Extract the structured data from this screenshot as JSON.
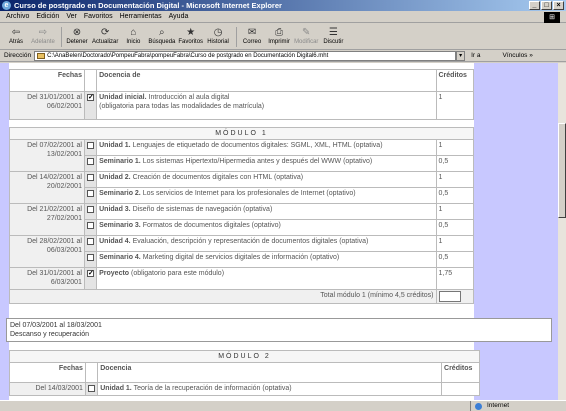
{
  "window": {
    "title": "Curso de postgrado en Documentación Digital - Microsoft Internet Explorer",
    "controls": [
      "_",
      "□",
      "×"
    ]
  },
  "menu": [
    "Archivo",
    "Edición",
    "Ver",
    "Favoritos",
    "Herramientas",
    "Ayuda"
  ],
  "toolbar": [
    {
      "label": "Atrás",
      "icon": "back-arrow",
      "glyph": "⇦",
      "enabled": true
    },
    {
      "label": "Adelante",
      "icon": "forward-arrow",
      "glyph": "⇨",
      "enabled": false
    },
    {
      "label": "Detener",
      "icon": "stop",
      "glyph": "⊗",
      "enabled": true
    },
    {
      "label": "Actualizar",
      "icon": "refresh",
      "glyph": "⟳",
      "enabled": true
    },
    {
      "label": "Inicio",
      "icon": "home",
      "glyph": "⌂",
      "enabled": true
    },
    {
      "label": "Búsqueda",
      "icon": "search",
      "glyph": "⌕",
      "enabled": true
    },
    {
      "label": "Favoritos",
      "icon": "favorites",
      "glyph": "★",
      "enabled": true
    },
    {
      "label": "Historial",
      "icon": "history",
      "glyph": "◷",
      "enabled": true
    },
    {
      "label": "Correo",
      "icon": "mail",
      "glyph": "✉",
      "enabled": true
    },
    {
      "label": "Imprimir",
      "icon": "print",
      "glyph": "⎙",
      "enabled": true
    },
    {
      "label": "Modificar",
      "icon": "edit",
      "glyph": "✎",
      "enabled": false
    },
    {
      "label": "Discutir",
      "icon": "discuss",
      "glyph": "☰",
      "enabled": true
    }
  ],
  "address": {
    "label": "Dirección",
    "value": "C:\\AnaBelen\\Doctorado\\PompeuFabra\\pompeuFabra\\Curso de postgrado en Documentación Digital6.mht",
    "go": "Ir a",
    "links": "Vínculos »"
  },
  "table1": {
    "headers": {
      "fechas": "Fechas",
      "docencia": "Docencia de",
      "creditos": "Créditos"
    },
    "row": {
      "date": "Del 31/01/2001 al 06/02/2001",
      "checked": true,
      "title": "Unidad inicial.",
      "text": " Introducción al aula digital",
      "note": "(obligatoria para todas las modalidades de matrícula)",
      "credit": "1"
    }
  },
  "modulo1": {
    "title": "MÓDULO 1",
    "groups": [
      {
        "date": "Del 07/02/2001 al 13/02/2001",
        "items": [
          {
            "title": "Unidad 1.",
            "text": " Lenguajes de etiquetado de documentos digitales: SGML, XML, HTML (optativa)",
            "credit": "1",
            "checked": false
          },
          {
            "title": "Seminario 1.",
            "text": " Los sistemas Hipertexto/Hipermedia antes y después del WWW (optativo)",
            "credit": "0,5",
            "checked": false
          }
        ]
      },
      {
        "date": "Del 14/02/2001 al 20/02/2001",
        "items": [
          {
            "title": "Unidad 2.",
            "text": " Creación de documentos digitales con HTML (optativa)",
            "credit": "1",
            "checked": false
          },
          {
            "title": "Seminario 2.",
            "text": " Los servicios de Internet para los profesionales de Internet (optativo)",
            "credit": "0,5",
            "checked": false
          }
        ]
      },
      {
        "date": "Del 21/02/2001 al 27/02/2001",
        "items": [
          {
            "title": "Unidad 3.",
            "text": " Diseño de sistemas de navegación (optativa)",
            "credit": "1",
            "checked": false
          },
          {
            "title": "Seminario 3.",
            "text": " Formatos de documentos digitales (optativo)",
            "credit": "0,5",
            "checked": false
          }
        ]
      },
      {
        "date": "Del 28/02/2001 al 06/03/2001",
        "items": [
          {
            "title": "Unidad 4.",
            "text": " Evaluación, descripción y representación de documentos digitales (optativa)",
            "credit": "1",
            "checked": false
          },
          {
            "title": "Seminario 4.",
            "text": " Marketing digital de servicios digitales de información (optativo)",
            "credit": "0,5",
            "checked": false
          }
        ]
      },
      {
        "date": "Del 31/01/2001 al 6/03/2001",
        "items": [
          {
            "title": "Proyecto",
            "text": " (obligatorio para este módulo)",
            "credit": "1,75",
            "checked": true
          }
        ]
      }
    ],
    "total": "Total módulo 1 (mínimo 4,5 créditos)"
  },
  "descanso": {
    "line1": "Del 07/03/2001 al 18/03/2001",
    "line2": "Descanso y recuperación"
  },
  "modulo2": {
    "title": "MÓDULO 2",
    "headers": {
      "fechas": "Fechas",
      "docencia": "Docencia",
      "creditos": "Créditos"
    },
    "row": {
      "date": "Del 14/03/2001",
      "title": "Unidad 1.",
      "text": " Teoría de la recuperación de información (optativa)",
      "checked": false
    }
  },
  "status": {
    "text": "",
    "zone": "Internet"
  }
}
